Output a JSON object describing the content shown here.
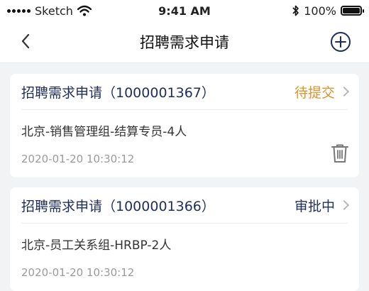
{
  "status_bar": {
    "carrier": "Sketch",
    "time": "9:41 AM",
    "battery": "100%",
    "battery_level": 1.0
  },
  "nav": {
    "title": "招聘需求申请",
    "back_icon": "chevron-left-icon",
    "add_icon": "plus-circle-icon"
  },
  "colors": {
    "title": "#1f2d5a",
    "pending": "#e0922a",
    "reviewing": "#1f2d5a",
    "time": "#9a9a9a"
  },
  "cards": [
    {
      "title": "招聘需求申请（1000001367）",
      "status": "待提交",
      "status_color": "#e0922a",
      "description": "北京-销售管理组-结算专员-4人",
      "time": "2020-01-20 10:30:12",
      "delete_icon": "trash-icon"
    },
    {
      "title": "招聘需求申请（1000001366）",
      "status": "审批中",
      "status_color": "#1f2d5a",
      "description": "北京-员工关系组-HRBP-2人",
      "time": "2020-01-20 10:30:12"
    }
  ]
}
